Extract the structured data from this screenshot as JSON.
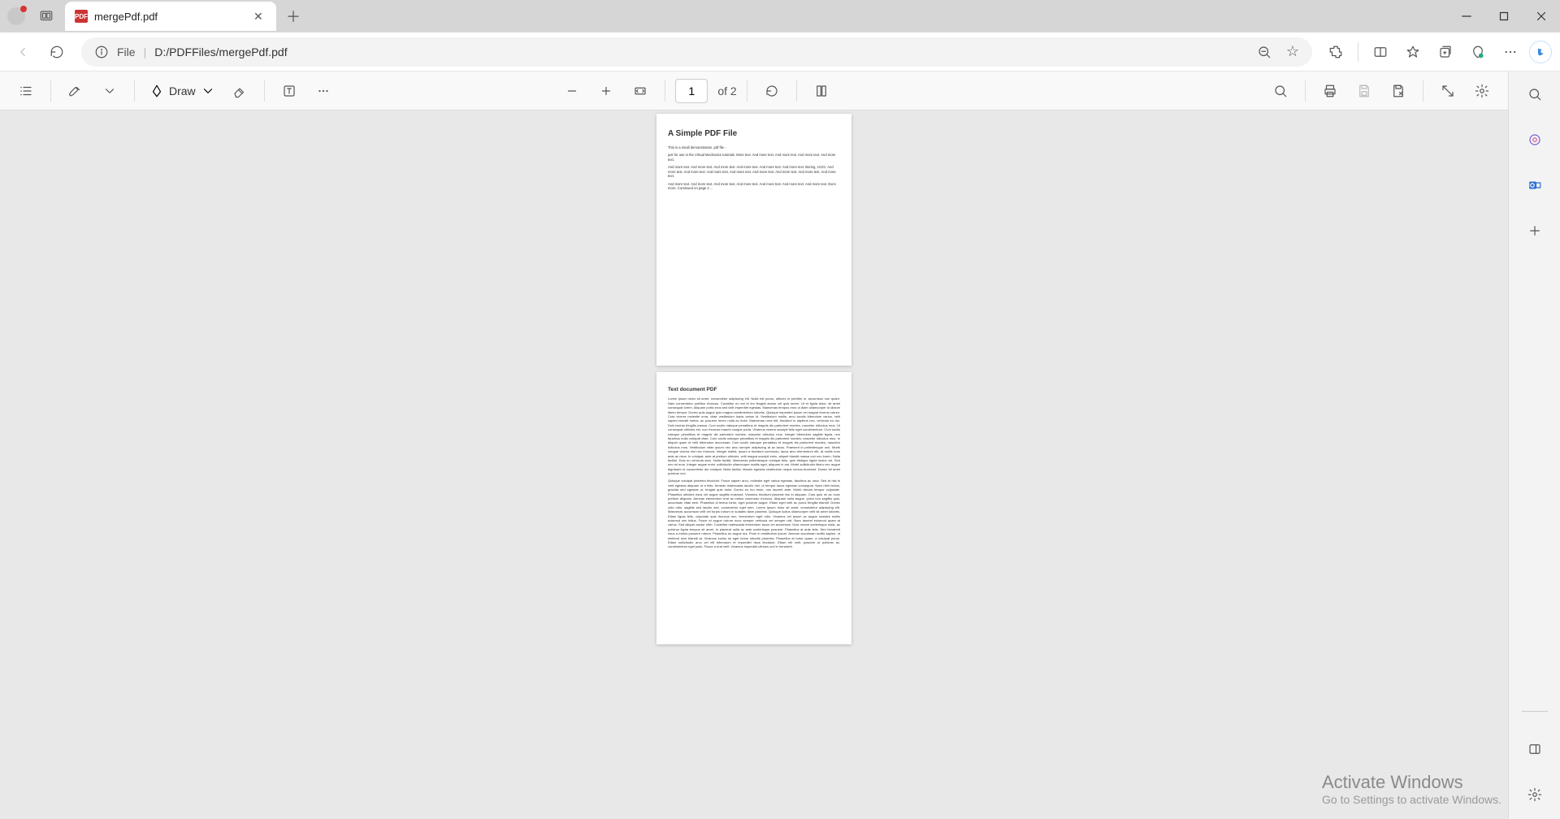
{
  "tab": {
    "title": "mergePdf.pdf"
  },
  "address": {
    "scheme_label": "File",
    "path": "D:/PDFFiles/mergePdf.pdf"
  },
  "pdf_toolbar": {
    "draw_label": "Draw",
    "current_page": "1",
    "total_pages_label": "of 2"
  },
  "document": {
    "page1": {
      "title": "A Simple PDF File",
      "p1": "This is a small demonstration .pdf file -",
      "p2": "just for use in the Virtual Mechanics tutorials. More text. And more text. And more text. And more text. And more text.",
      "p3": "And more text. And more text. And more text. And more text. And more text. And more text. Boring, zzzzz. And more text. And more text. And more text. And more text. And more text. And more text. And more text. And more text.",
      "p4": "And more text. And more text. And more text. And more text. And more text. And more text. And more text. Even more. Continued on page 2 ..."
    },
    "page2": {
      "title": "Text document PDF",
      "body1": "Lorem ipsum dolor sit amet, consectetur adipiscing elit. Nulla est purus, ultrices in porttitor in, accumsan non quam. Nam consectetur porttitor rhoncus. Curabitur eu est et leo feugiat auctor vel quis lorem. Ut et ligula dolor, sit amet consequat lorem. Aliquam porta eros sed velit imperdiet egestas. Maecenas tempus eros ut diam ullamcorper id dictum libero tempor. Donec quis augue quis magna condimentum lobortis. Quisque imperdiet ipsum vel magna viverra rutrum. Cras viverra molestie urna, vitae vestibulum turpis varius id. Vestibulum mollis, arcu iaculis bibendum varius, velit sapien blandit metus, ac posuere lorem nulla ac dolor. Maecenas urna elit, tincidunt in dapibus nec, vehicula eu dui. Duis lacinia fringilla massa. Cum sociis natoque penatibus et magnis dis parturient montes, nascetur ridiculus mus. Ut consequat ultricies est, non rhoncus mauris congue porta. Vivamus viverra suscipit felis eget condimentum. Cum sociis natoque penatibus et magnis dis parturient montes, nascetur ridiculus mus. Integer bibendum sagittis ligula, non faucibus nulla volutpat vitae. Cum sociis natoque penatibus et magnis dis parturient montes, nascetur ridiculus mus. In aliquet quam et velit bibendum accumsan. Cum sociis natoque penatibus et magnis dis parturient montes, nascetur ridiculus mus. Vestibulum vitae ipsum nec arcu semper adipiscing at ac lacus. Praesent id pellentesque orci. Morbi congue viverra nisl nec rhoncus. Integer mattis, ipsum a tincidunt commodo, lacus arcu elementum elit, at mollis eros ante ac risus. In volutpat, ante at pretium ultricies, velit magna suscipit enim, aliquet blandit massa orci nec lorem. Nulla facilisi. Duis eu vehicula arcu. Nulla facilisi. Maecenas pellentesque volutpat felis, quis tristique ligula luctus vel. Sed nec mi eros. Integer augue enim, sollicitudin ullamcorper mattis eget, aliquam in est. Morbi sollicitudin libero nec augue dignissim ut consectetur dui volutpat. Nulla facilisi. Mauris egestas vestibulum neque cursus tincidunt. Donec sit amet pulvinar orci.",
      "body2": "Quisque volutpat pharetra tincidunt. Fusce sapien arcu, molestie eget varius egestas, faucibus ac urna. Sed at nisi in velit egestas aliquam ut a felis. Aenean malesuada iaculis nisl, ut tempor lacus egestas consequat. Nam nibh lectus, gravida sed egestas ut, feugiat quis dolor. Donec eu leo enim, non laoreet ante. Morbi dictum tempor vulputate. Phasellus ultricies risus vel augue sagittis euismod. Vivamus tincidunt placerat nisi in aliquam. Cras quis mi ac nunc pretium aliquam. Aenean elementum erat ac metus commodo rhoncus. Aliquam nulla augue, porta non sagittis quis, accumsan vitae sem. Phasellus id lectus tortor, eget pulvinar augue. Etiam eget velit ac purus fringilla blandit. Donec odio odio, sagittis sed iaculis sed, consectetur eget sem. Lorem ipsum dolor sit amet, consectetur adipiscing elit. Maecenas accumsan velit vel turpis rutrum in sodales diam placerat. Quisque luctus ullamcorper velit sit amet lobortis. Etiam ligula felis, vulputate quis rhoncus nec, fermentum eget odio. Vivamus vel ipsum ac augue sodales mollis euismod nec tellus. Fusce et augue rutrum nunc semper vehicula vel semper nisl. Nam laoreet euismod quam at varius. Sed aliquet auctor nibh. Curabitur malesuada fermentum lacus vel accumsan. Duis ornare scelerisque nulla, ac pulvinar ligula tempus sit amet. In placerat nulla ac ante scelerisque posuere. Phasellus at ante felis. Sed hendrerit risus a metus posuere rutrum. Phasellus eu augue dui. Proin in vestibulum ipsum. Aenean accumsan mollis sapien, ut eleifend sem blandit at. Vivamus luctus mi eget lorem lobortis pharetra. Phasellus at tortor quam, a volutpat purus. Etiam sollicitudin arcu vel elit bibendum et imperdiet risus tincidunt. Etiam elit velit, posuere ut pulvinar ac, condimentum eget justo. Fusce a erat velit. Vivamus imperdiet ultrices orci in hendrerit."
    }
  },
  "watermark": {
    "line1": "Activate Windows",
    "line2": "Go to Settings to activate Windows."
  }
}
